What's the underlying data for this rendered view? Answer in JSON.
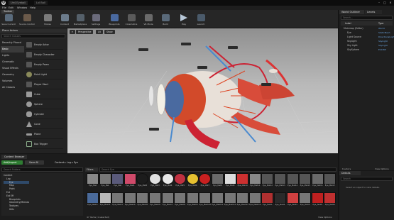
{
  "app": {
    "tabs": [
      "Ue4 Eyeball",
      "Lvl Ball"
    ],
    "menu": [
      "File",
      "Edit",
      "Window",
      "Help"
    ]
  },
  "toolbar": {
    "tab": "Toolbar",
    "tools": [
      {
        "label": "Save Current",
        "icon": "save-icon"
      },
      {
        "label": "Source Control",
        "icon": "source-control-icon"
      },
      {
        "label": "Modes",
        "icon": "modes-icon"
      },
      {
        "label": "Content",
        "icon": "content-icon"
      },
      {
        "label": "Marketplace",
        "icon": "marketplace-icon"
      },
      {
        "label": "Settings",
        "icon": "settings-icon"
      },
      {
        "label": "Blueprints",
        "icon": "blueprints-icon"
      },
      {
        "label": "Cinematics",
        "icon": "cinematics-icon"
      },
      {
        "label": "VR Mode",
        "icon": "vr-icon"
      },
      {
        "label": "Build",
        "icon": "build-icon"
      },
      {
        "label": "Play",
        "icon": "play-icon"
      },
      {
        "label": "Launch",
        "icon": "launch-icon"
      }
    ]
  },
  "modes": {
    "tab": "Place Actors",
    "search_placeholder": "Search Classes",
    "categories": [
      "Recently Placed",
      "Basic",
      "Lights",
      "Cinematic",
      "Visual Effects",
      "Geometry",
      "Volumes",
      "All Classes"
    ],
    "selected_category": "Basic",
    "items": [
      "Empty Actor",
      "Empty Character",
      "Empty Pawn",
      "Point Light",
      "Player Start",
      "Cube",
      "Sphere",
      "Cylinder",
      "Cone",
      "Plane",
      "Box Trigger"
    ]
  },
  "viewport": {
    "buttons": [
      "Perspective",
      "Lit",
      "Show"
    ]
  },
  "content_browser": {
    "tab": "Content Browser",
    "add_label": "Add/Import",
    "save_label": "Save All",
    "path": [
      "Content",
      "Lng",
      "Eye"
    ],
    "filters_label": "Filters",
    "search_placeholder": "Search Eye",
    "folder_search_placeholder": "Search Folders",
    "folders": [
      "Content",
      "Lng",
      "Eye",
      "Map",
      "Point",
      "Ext",
      "Ext Eff",
      "Blueprints",
      "Geometry/Meshes",
      "Textures",
      "Utils"
    ],
    "status": "47 items (1 selected)",
    "view_options": "View Options",
    "row1_labels": [
      "Eye_Mat",
      "Eye_Mat",
      "Eye_Mat",
      "Eye_Mat1",
      "Eye_Mat2",
      "Eye_Mat3",
      "Eye_Mat4",
      "Eye_Mat5",
      "Eye_Mat6",
      "Eye_Mat7",
      "Eye_Mat8",
      "Eye_Mat9",
      "Eye_Mat10",
      "Eye_Mat11",
      "Eye_Mat12",
      "Eye_Mat13",
      "Eye_Mat14",
      "Eye_Mat15",
      "Eye_Mat16",
      "Eye_Mat17"
    ],
    "row2_labels": [
      "Eye_Mesh1",
      "Eye_Mesh2",
      "Eye_Mesh3",
      "Eye_Mesh4",
      "Eye_Mesh5",
      "Eye_Mesh6",
      "Eye_Mesh7",
      "Eye_Mesh8",
      "Eye_Mesh9",
      "Eye_Mesh10",
      "Eye_Mesh11",
      "Eye_Mesh12",
      "Eye_Mesh13",
      "Eye_Mesh14",
      "Eye_Tex01",
      "Eye_Tex02",
      "Eye_Tex03",
      "Eye_Tex04",
      "Eye_Tex05",
      "Eye_Tex06"
    ]
  },
  "outliner": {
    "tabs": [
      "World Outliner",
      "Levels"
    ],
    "search_placeholder": "Search...",
    "columns": [
      "Label",
      "Type"
    ],
    "rows": [
      {
        "label": "Mainmap (Editor)",
        "type": "World"
      },
      {
        "label": "Eye",
        "type": "StaticMesh"
      },
      {
        "label": "Light Source",
        "type": "DirectionalLight"
      },
      {
        "label": "SkyLight",
        "type": "SkyLight"
      },
      {
        "label": "Sky Light",
        "type": "SkyLight"
      },
      {
        "label": "SkySphere",
        "type": "Edit BP"
      }
    ],
    "actors": "6 actors",
    "view_options": "View Options"
  },
  "details": {
    "tab": "Details",
    "search_placeholder": "Search",
    "empty": "Select an object to view details."
  }
}
